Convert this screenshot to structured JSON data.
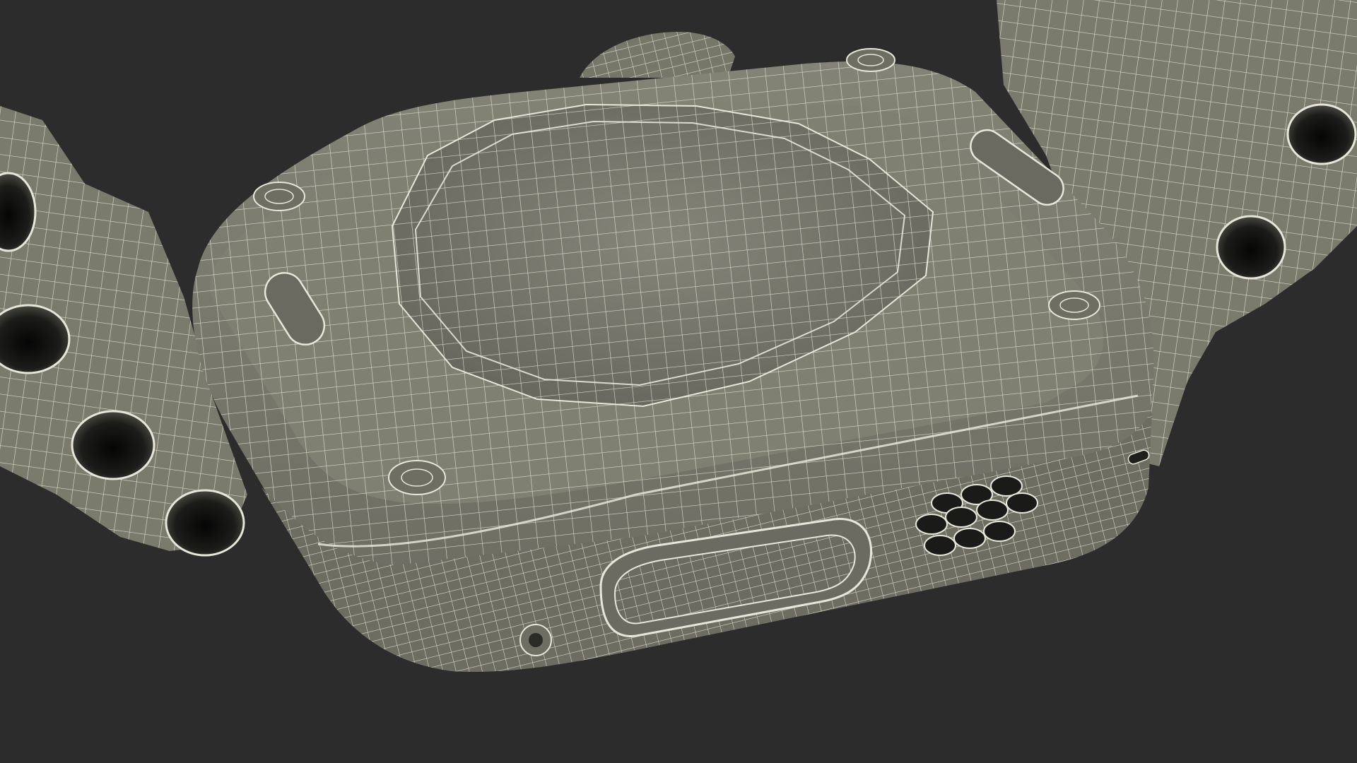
{
  "scene": {
    "subject": "wireframe-render-watch-rear-with-band",
    "render_style": "wireframe-over-shaded",
    "colors": {
      "background": "#2c2c2c",
      "surface": "#7b7b6e",
      "surface_light": "#8c8c7f",
      "surface_dark": "#5e5e54",
      "wire": "#e6e6da",
      "hole": "#141414"
    }
  }
}
